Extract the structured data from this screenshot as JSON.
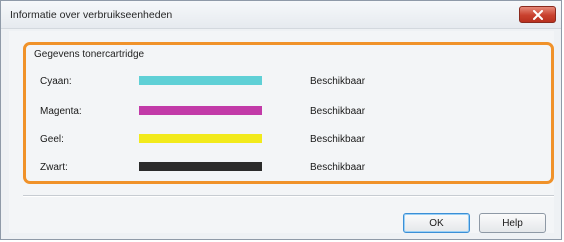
{
  "window": {
    "title": "Informatie over verbruikseenheden",
    "close_glyph": "✕"
  },
  "group": {
    "title": "Gegevens tonercartridge"
  },
  "toners": [
    {
      "name": "Cyaan:",
      "color": "#5fd0d6",
      "status": "Beschikbaar"
    },
    {
      "name": "Magenta:",
      "color": "#c23aa8",
      "status": "Beschikbaar"
    },
    {
      "name": "Geel:",
      "color": "#f2ea1c",
      "status": "Beschikbaar"
    },
    {
      "name": "Zwart:",
      "color": "#2b2b2b",
      "status": "Beschikbaar"
    }
  ],
  "buttons": {
    "ok": "OK",
    "help": "Help"
  },
  "colors": {
    "highlight": "#f0922a",
    "close": "#c9412e"
  }
}
